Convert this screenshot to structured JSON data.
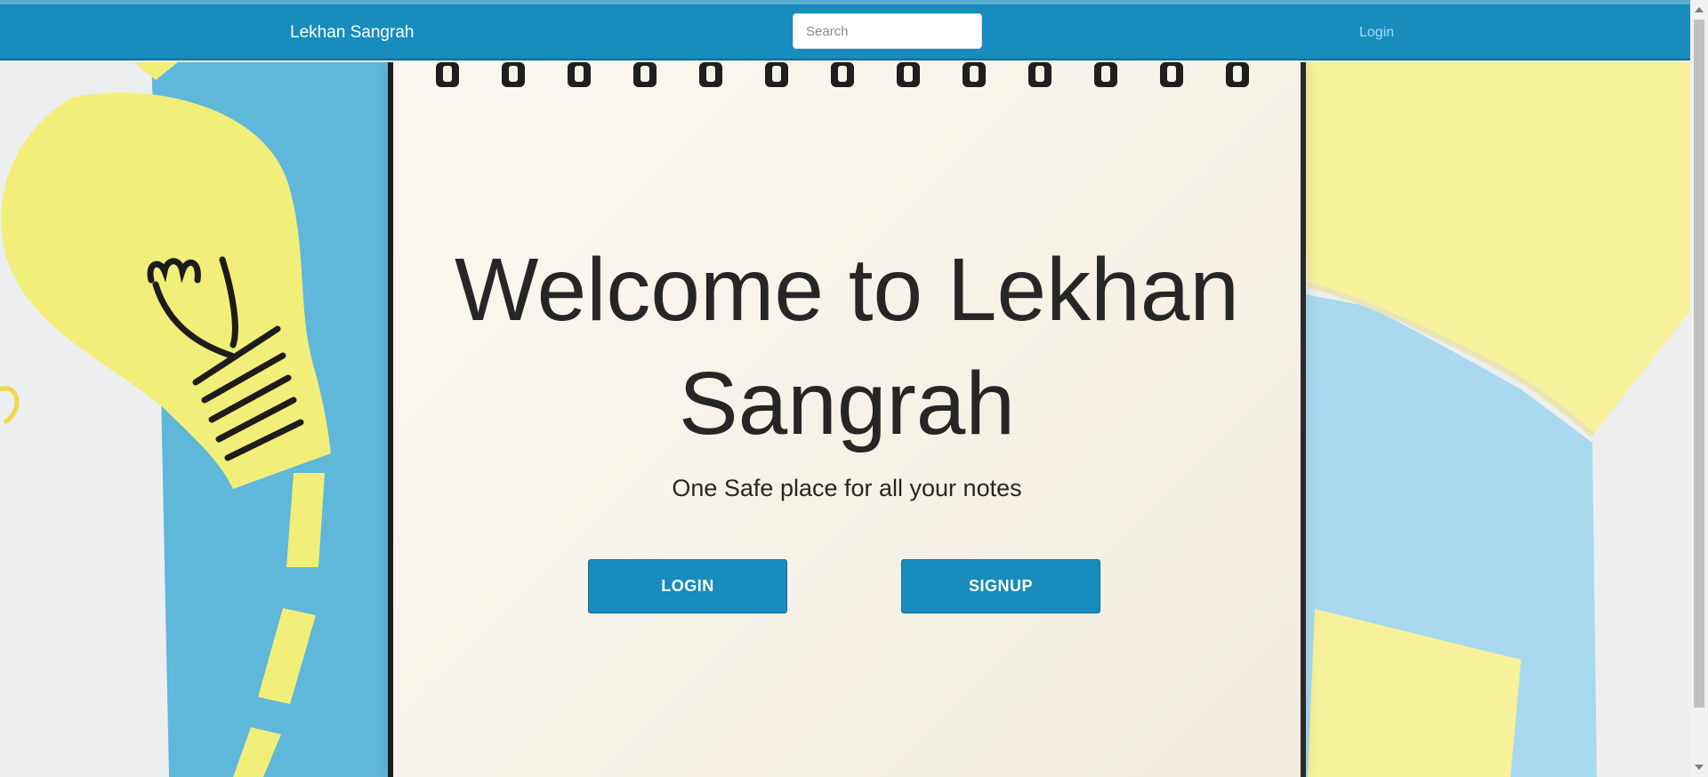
{
  "navbar": {
    "brand": "Lekhan Sangrah",
    "search_placeholder": "Search",
    "login_link": "Login"
  },
  "hero": {
    "title_line1": "Welcome to Lekhan",
    "title_line2": "Sangrah",
    "subtitle": "One Safe place for all your notes",
    "login_button": "LOGIN",
    "signup_button": "SIGNUP"
  },
  "colors": {
    "accent": "#178cbd",
    "paper_blue": "#5fb7da",
    "paper_yellow": "#f2ee7a",
    "notepad": "#f7f3ea",
    "text": "#262626"
  }
}
